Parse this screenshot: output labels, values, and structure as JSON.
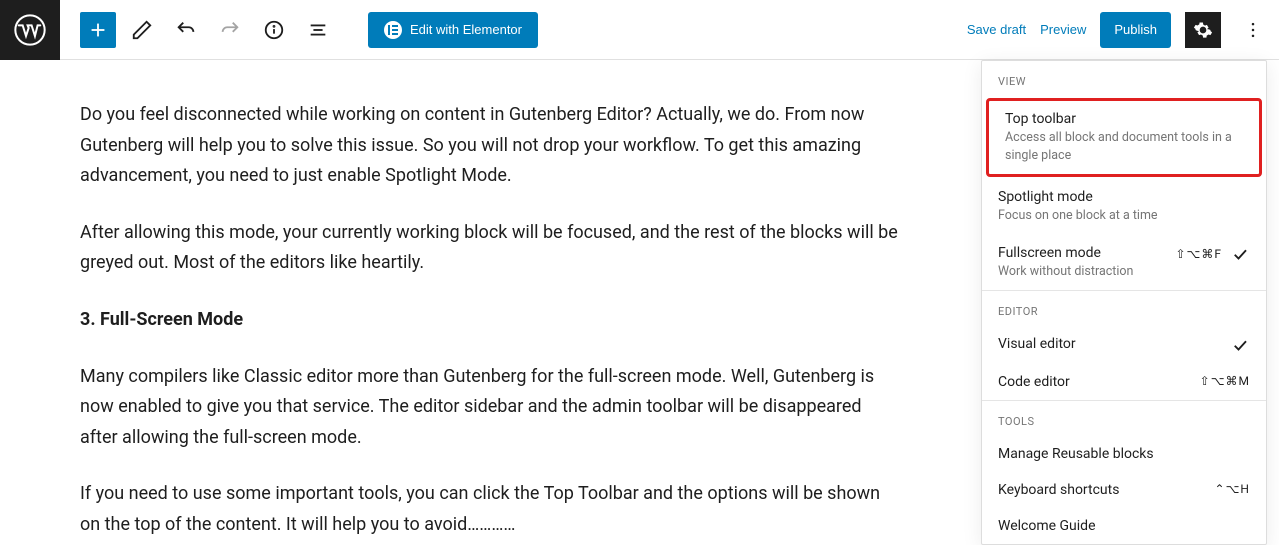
{
  "toolbar": {
    "elementor_label": "Edit with Elementor",
    "save_draft": "Save draft",
    "preview": "Preview",
    "publish": "Publish"
  },
  "content": {
    "p1": "Do you feel disconnected while working on content in Gutenberg Editor? Actually, we do. From now Gutenberg will help you to solve this issue. So you will not drop your workflow. To get this amazing advancement, you need to just enable Spotlight Mode.",
    "p2": "After allowing this mode, your currently working block will be focused, and the rest of the blocks will be greyed out. Most of the editors like heartily.",
    "h3": "3. Full-Screen Mode",
    "p3": "Many compilers like Classic editor more than Gutenberg for the full-screen mode. Well, Gutenberg is now enabled to give you that service. The editor sidebar and the admin toolbar will be disappeared after allowing the full-screen mode.",
    "p4": "If you need to use some important tools, you can click the Top Toolbar and the options will be shown on the top of the content. It will help you to avoid…………"
  },
  "dropdown": {
    "sections": {
      "view": "VIEW",
      "editor": "EDITOR",
      "tools": "TOOLS"
    },
    "items": {
      "top_toolbar": {
        "label": "Top toolbar",
        "desc": "Access all block and document tools in a single place"
      },
      "spotlight": {
        "label": "Spotlight mode",
        "desc": "Focus on one block at a time"
      },
      "fullscreen": {
        "label": "Fullscreen mode",
        "desc": "Work without distraction",
        "shortcut": "⇧⌥⌘F"
      },
      "visual": {
        "label": "Visual editor"
      },
      "code": {
        "label": "Code editor",
        "shortcut": "⇧⌥⌘M"
      },
      "reusable": {
        "label": "Manage Reusable blocks"
      },
      "shortcuts": {
        "label": "Keyboard shortcuts",
        "shortcut": "⌃⌥H"
      },
      "welcome": {
        "label": "Welcome Guide"
      }
    }
  }
}
